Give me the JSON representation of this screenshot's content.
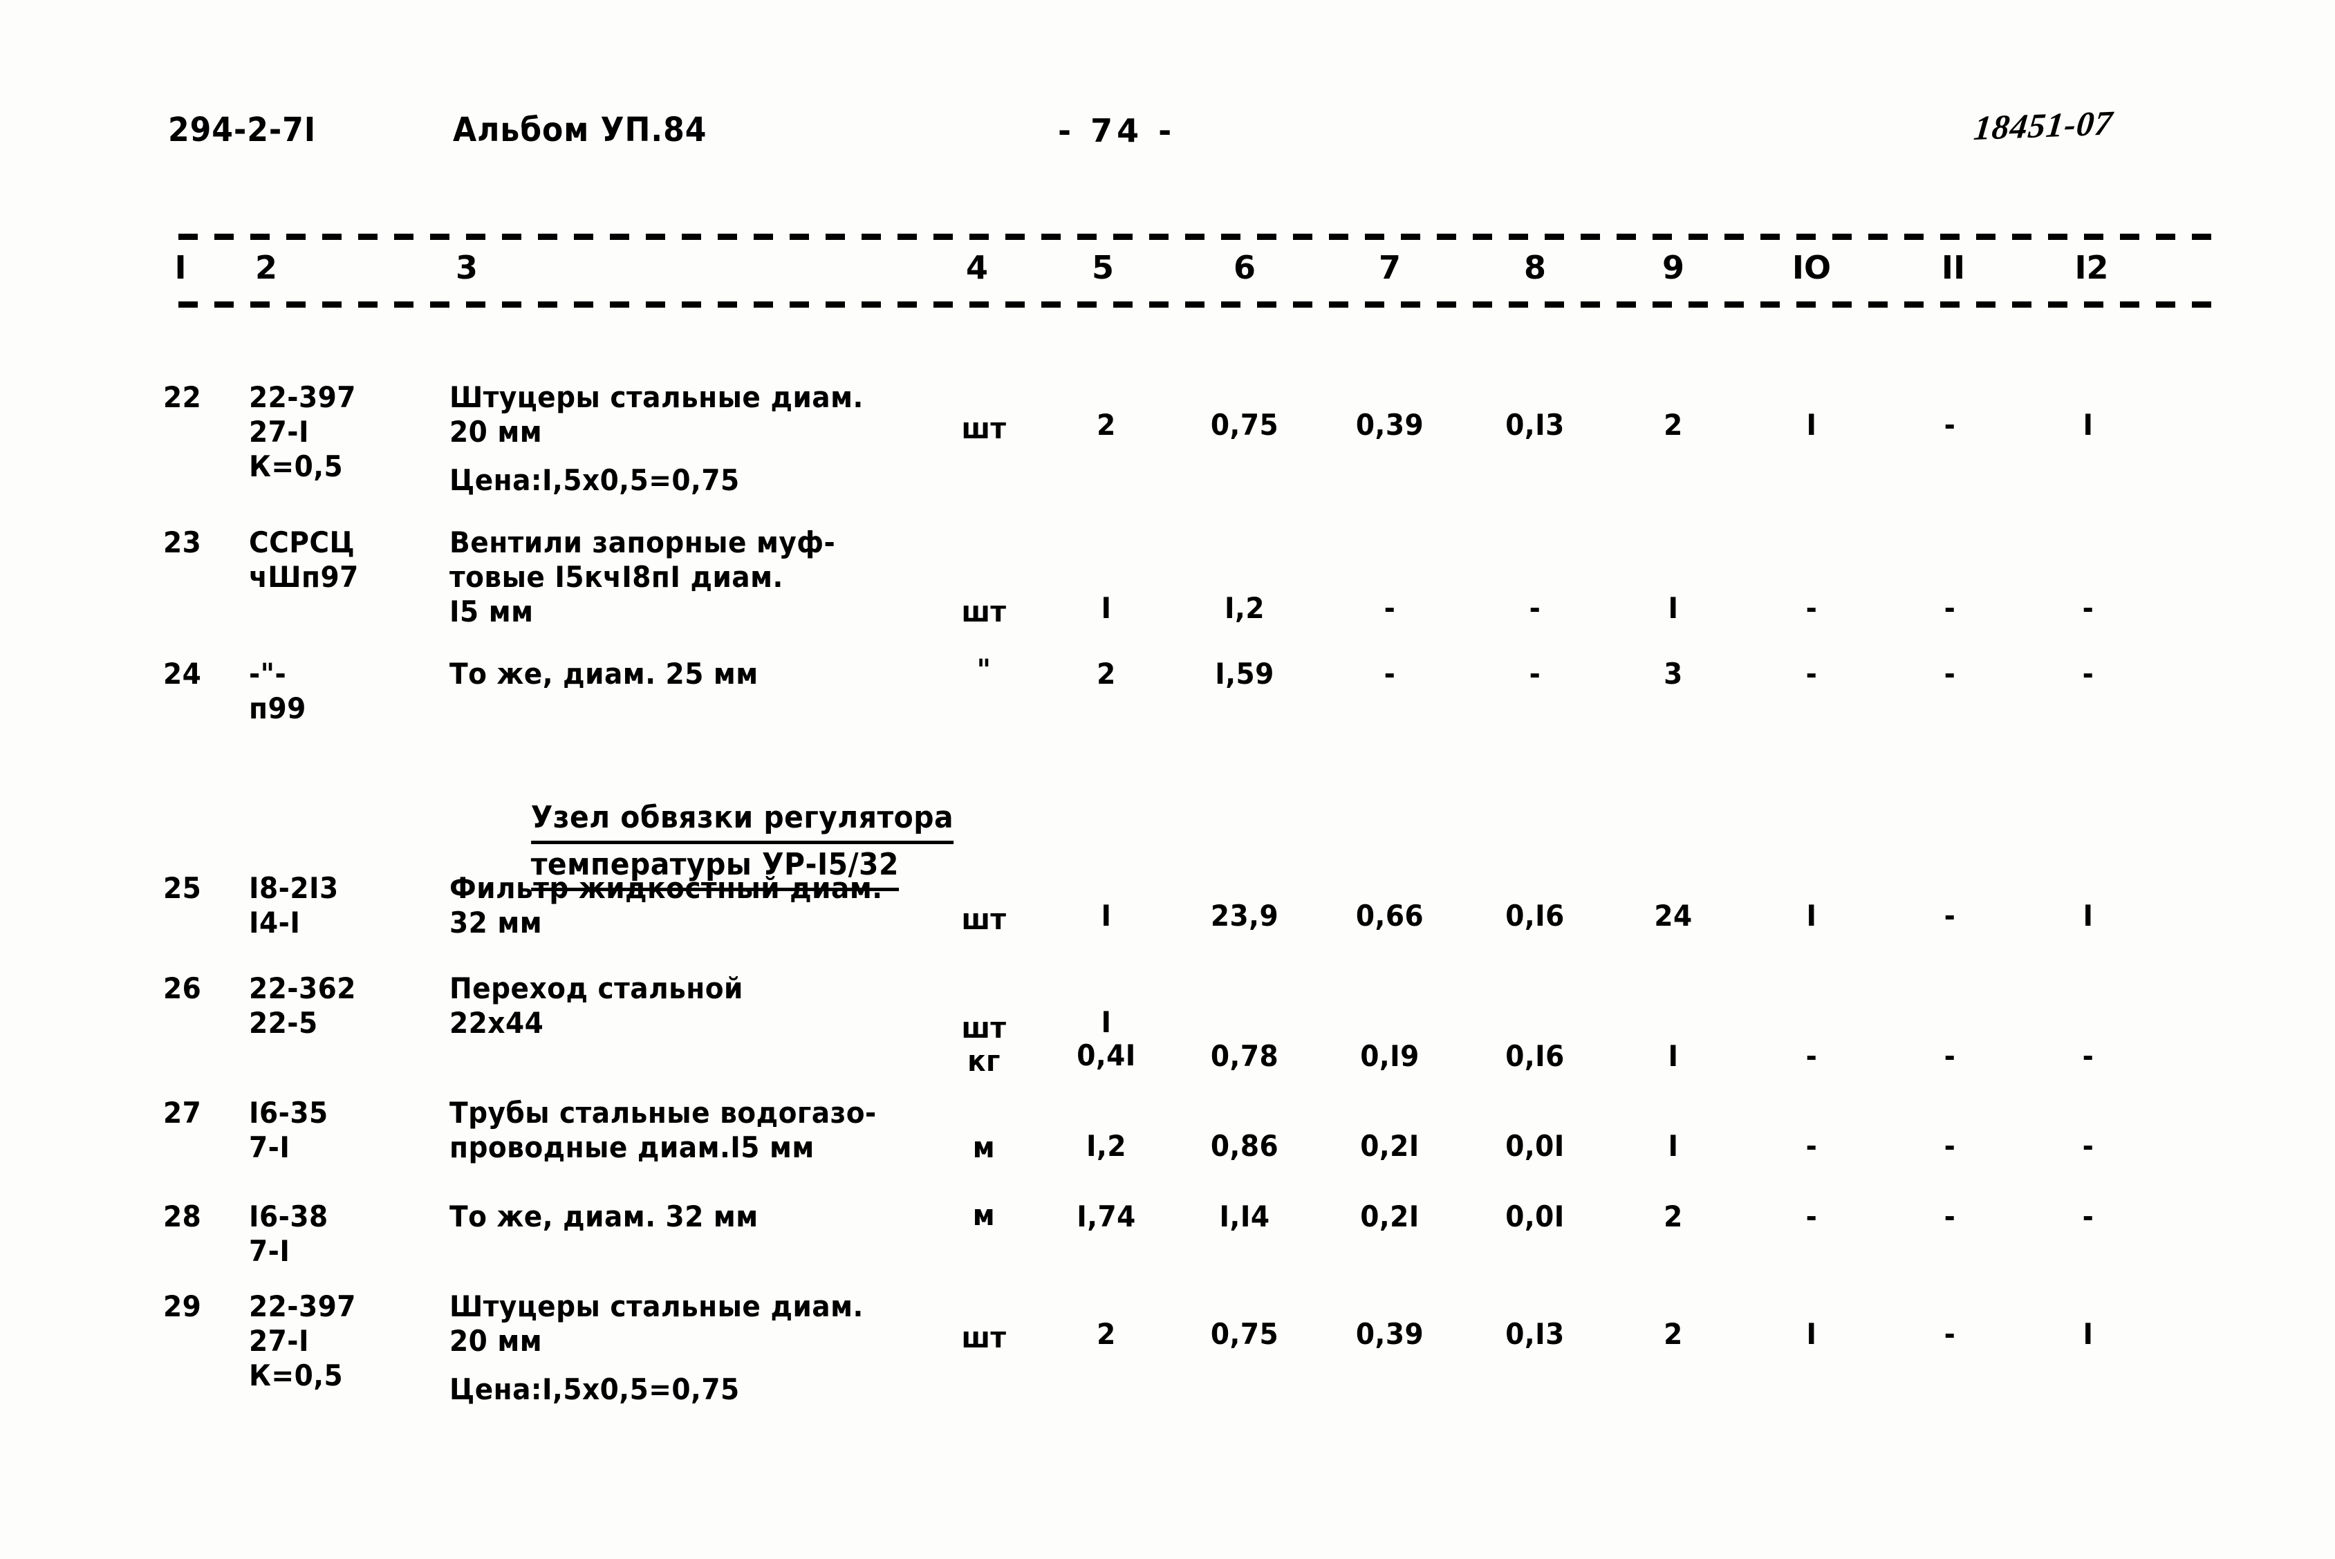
{
  "header": {
    "doc_code": "294-2-7I",
    "album": "Альбом УП.84",
    "page_number": "- 74 -",
    "stamp": "18451-07"
  },
  "table": {
    "column_numbers": [
      "I",
      "2",
      "3",
      "4",
      "5",
      "6",
      "7",
      "8",
      "9",
      "IO",
      "II",
      "I2"
    ],
    "rows": [
      {
        "no": "22",
        "code": "22-397\n27-I\nК=0,5",
        "name": "Штуцеры стальные диам.\n20 мм",
        "name2": "Цена:I,5х0,5=0,75",
        "unit": "шт",
        "v5": "2",
        "v6": "0,75",
        "v7": "0,39",
        "v8": "0,I3",
        "v9": "2",
        "v10": "I",
        "v11": "-",
        "v12": "I"
      },
      {
        "no": "23",
        "code": "ССРСЦ\nчШп97",
        "name": "Вентили запорные муф-\nтовые I5кчI8пI диам.\nI5 мм",
        "name2": "",
        "unit": "шт",
        "v5": "I",
        "v6": "I,2",
        "v7": "-",
        "v8": "-",
        "v9": "I",
        "v10": "-",
        "v11": "-",
        "v12": "-"
      },
      {
        "no": "24",
        "code": "-\"-\nп99",
        "name": "То же, диам. 25 мм",
        "name2": "",
        "unit": "\"",
        "v5": "2",
        "v6": "I,59",
        "v7": "-",
        "v8": "-",
        "v9": "3",
        "v10": "-",
        "v11": "-",
        "v12": "-"
      },
      {
        "no": "25",
        "code": "I8-2I3\nI4-I",
        "name": "Фильтр жидкостный диам.\n32 мм",
        "name2": "",
        "unit": "шт",
        "v5": "I",
        "v6": "23,9",
        "v7": "0,66",
        "v8": "0,I6",
        "v9": "24",
        "v10": "I",
        "v11": "-",
        "v12": "I"
      },
      {
        "no": "26",
        "code": "22-362\n22-5",
        "name": "Переход стальной\n22х44",
        "name2": "",
        "unit": "шт\nкг",
        "v5": "I\n0,4I",
        "v6": "0,78",
        "v7": "0,I9",
        "v8": "0,I6",
        "v9": "I",
        "v10": "-",
        "v11": "-",
        "v12": "-"
      },
      {
        "no": "27",
        "code": "I6-35\n7-I",
        "name": "Трубы стальные водогазо-\nпроводные диам.I5 мм",
        "name2": "",
        "unit": "м",
        "v5": "I,2",
        "v6": "0,86",
        "v7": "0,2I",
        "v8": "0,0I",
        "v9": "I",
        "v10": "-",
        "v11": "-",
        "v12": "-"
      },
      {
        "no": "28",
        "code": "I6-38\n7-I",
        "name": "То же, диам. 32 мм",
        "name2": "",
        "unit": "м",
        "v5": "I,74",
        "v6": "I,I4",
        "v7": "0,2I",
        "v8": "0,0I",
        "v9": "2",
        "v10": "-",
        "v11": "-",
        "v12": "-"
      },
      {
        "no": "29",
        "code": "22-397\n27-I\nК=0,5",
        "name": "Штуцеры стальные диам.\n20 мм",
        "name2": "Цена:I,5х0,5=0,75",
        "unit": "шт",
        "v5": "2",
        "v6": "0,75",
        "v7": "0,39",
        "v8": "0,I3",
        "v9": "2",
        "v10": "I",
        "v11": "-",
        "v12": "I"
      }
    ],
    "section_heading": {
      "line1": "Узел обвязки регулятора",
      "line2": "температуры УР-I5/32"
    }
  }
}
